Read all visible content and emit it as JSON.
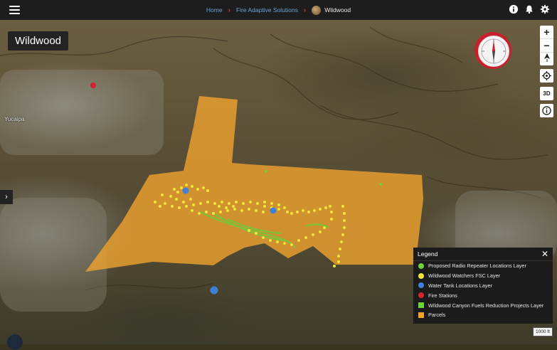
{
  "nav": {
    "menu_icon": "hamburger-menu-icon",
    "breadcrumbs": {
      "home": "Home",
      "org": "Fire Adaptive Solutions",
      "current": "Wildwood"
    },
    "icons": [
      "info-icon",
      "bell-icon",
      "gear-icon"
    ]
  },
  "map": {
    "title": "Wildwood",
    "place_label": "Yucaipa",
    "controls": {
      "zoom_in": "+",
      "zoom_out": "−",
      "mode_3d": "3D"
    },
    "scale_bar": "1000 ft"
  },
  "legend": {
    "title": "Legend",
    "close": "✕",
    "items": [
      {
        "label": "Proposed Radio Repeater Locations Layer",
        "color": "#6fd33a",
        "shape": "circle"
      },
      {
        "label": "Wildwood Watchers FSC Layer",
        "color": "#f2e53a",
        "shape": "circle"
      },
      {
        "label": "Water Tank Locations Layer",
        "color": "#3f7fd8",
        "shape": "circle"
      },
      {
        "label": "Fire Stations",
        "color": "#d8222a",
        "shape": "circle"
      },
      {
        "label": "Wildwood Canyon Fuels Reduction Projects Layer",
        "color": "#6fd33a",
        "shape": "square"
      },
      {
        "label": "Parcels",
        "color": "#f0a22e",
        "shape": "square"
      }
    ]
  },
  "colors": {
    "parcel_fill": "#f0a22e",
    "watchers": "#f2e53a",
    "fuels_line": "#7dc23a",
    "water_tank": "#3f7fd8",
    "fire_station": "#d8222a",
    "accent_link": "#6aa3d8"
  }
}
